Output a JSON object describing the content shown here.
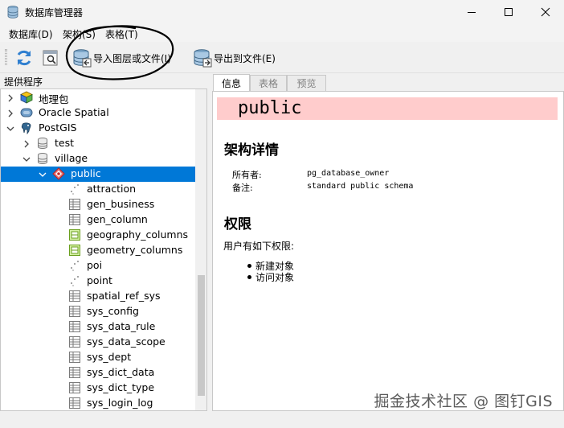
{
  "window": {
    "title": "数据库管理器",
    "minimize_icon": "minimize-icon",
    "maximize_icon": "maximize-icon",
    "close_icon": "close-icon"
  },
  "menu": [
    "数据库(D)",
    "架构(S)",
    "表格(T)"
  ],
  "toolbar": {
    "refresh_icon": "refresh-icon",
    "sql_icon": "sql-window-icon",
    "import_label": "导入图层或文件(I)",
    "export_label": "导出到文件(E)"
  },
  "providers_panel": {
    "title": "提供程序",
    "tree": [
      {
        "label": "地理包",
        "icon": "geopackage-icon",
        "expanded": false
      },
      {
        "label": "Oracle Spatial",
        "icon": "oracle-icon",
        "expanded": false
      },
      {
        "label": "PostGIS",
        "icon": "postgis-elephant-icon",
        "expanded": true
      },
      {
        "label": "test",
        "icon": "database-icon",
        "expanded": false
      },
      {
        "label": "village",
        "icon": "database-icon",
        "expanded": true
      },
      {
        "label": "public",
        "icon": "schema-icon",
        "expanded": true,
        "selected": true
      },
      {
        "label": "attraction",
        "icon": "point-layer-icon"
      },
      {
        "label": "gen_business",
        "icon": "table-icon"
      },
      {
        "label": "gen_column",
        "icon": "table-icon"
      },
      {
        "label": "geography_columns",
        "icon": "view-icon"
      },
      {
        "label": "geometry_columns",
        "icon": "view-icon"
      },
      {
        "label": "poi",
        "icon": "point-layer-icon"
      },
      {
        "label": "point",
        "icon": "point-layer-icon"
      },
      {
        "label": "spatial_ref_sys",
        "icon": "table-icon"
      },
      {
        "label": "sys_config",
        "icon": "table-icon"
      },
      {
        "label": "sys_data_rule",
        "icon": "table-icon"
      },
      {
        "label": "sys_data_scope",
        "icon": "table-icon"
      },
      {
        "label": "sys_dept",
        "icon": "table-icon"
      },
      {
        "label": "sys_dict_data",
        "icon": "table-icon"
      },
      {
        "label": "sys_dict_type",
        "icon": "table-icon"
      },
      {
        "label": "sys_login_log",
        "icon": "table-icon"
      }
    ]
  },
  "tabs": [
    "信息",
    "表格",
    "预览"
  ],
  "info": {
    "schema_name": "public",
    "details_heading": "架构详情",
    "owner_label": "所有者:",
    "owner_value": "pg_database_owner",
    "comment_label": "备注:",
    "comment_value": "standard public schema",
    "privileges_heading": "权限",
    "privileges_intro": "用户有如下权限:",
    "privileges": [
      "新建对象",
      "访问对象"
    ]
  },
  "watermark": "掘金技术社区 @ 图钉GIS",
  "colors": {
    "selection": "#0078d7",
    "schema_banner": "#ffcccc",
    "annotation_stroke": "#000000"
  }
}
